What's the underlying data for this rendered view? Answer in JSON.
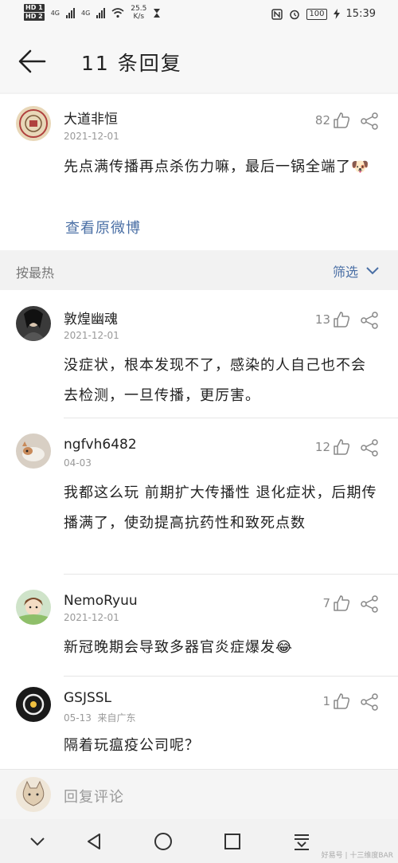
{
  "status": {
    "sim1": "HD 1",
    "sim2": "HD 2",
    "network1": "4G",
    "network2": "4G",
    "speed_value": "25.5",
    "speed_unit": "K/s",
    "battery": "100",
    "time": "15:39"
  },
  "header": {
    "title": "11 条回复"
  },
  "main_post": {
    "username": "大道非恒",
    "date": "2021-12-01",
    "likes": "82",
    "text": "先点满传播再点杀伤力嘛，最后一锅全端了",
    "emoji": "🐶",
    "link": "查看原微博"
  },
  "sort": {
    "label": "按最热",
    "filter": "筛选"
  },
  "comments": [
    {
      "username": "敦煌幽魂",
      "date": "2021-12-01",
      "likes": "13",
      "text": "没症状，根本发现不了，感染的人自己也不会去检测，一旦传播，更厉害。"
    },
    {
      "username": "ngfvh6482",
      "date": "04-03",
      "likes": "12",
      "text": "我都这么玩 前期扩大传播性 退化症状，后期传播满了，使劲提高抗药性和致死点数"
    },
    {
      "username": "NemoRyuu",
      "date": "2021-12-01",
      "likes": "7",
      "text": "新冠晚期会导致多器官炎症爆发",
      "emoji": "😂"
    },
    {
      "username": "GSJSSL",
      "date": "05-13",
      "location": "来自广东",
      "likes": "1",
      "text": "隔着玩瘟疫公司呢？"
    }
  ],
  "reply": {
    "placeholder": "回复评论"
  },
  "watermark": "好易号 | 十三维度BAR",
  "colors": {
    "link": "#4a6fa5",
    "muted": "#999999",
    "background": "#f2f2f2"
  }
}
